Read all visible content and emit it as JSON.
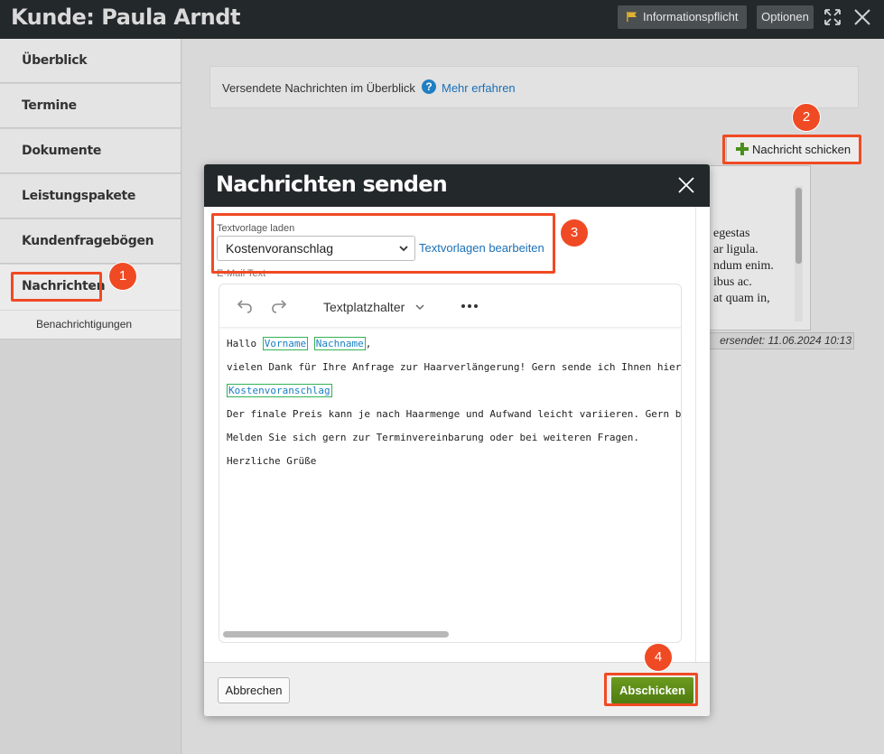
{
  "header": {
    "title": "Kunde: Paula Arndt",
    "info_button": "Informationspflicht",
    "options_button": "Optionen"
  },
  "sidebar": {
    "items": [
      {
        "label": "Überblick"
      },
      {
        "label": "Termine"
      },
      {
        "label": "Dokumente"
      },
      {
        "label": "Leistungspakete"
      },
      {
        "label": "Kundenfragebögen"
      }
    ],
    "active_item": "Nachrichten",
    "sub_item": "Benachrichtigungen"
  },
  "main": {
    "info_text": "Versendete Nachrichten im Überblick",
    "info_link": "Mehr erfahren",
    "new_message_button": "Nachricht schicken",
    "message_preview_lines": [
      "egestas",
      "ar ligula.",
      "ndum enim.",
      "ibus ac.",
      "at quam in,"
    ],
    "sent_label": "ersendet: 11.06.2024 10:13"
  },
  "modal": {
    "title": "Nachrichten senden",
    "template_label": "Textvorlage laden",
    "template_selected": "Kostenvoranschlag",
    "template_edit_link": "Textvorlagen bearbeiten",
    "email_label": "E-Mail Text",
    "toolbar": {
      "placeholder_menu": "Textplatzhalter"
    },
    "email_body": {
      "greeting": "Hallo",
      "ph_first": "Vorname",
      "ph_last": "Nachname",
      "comma": ",",
      "line2": "vielen Dank für Ihre Anfrage zur Haarverlängerung! Gern sende ich Ihnen hier",
      "ph_quote": "Kostenvoranschlag",
      "line4": "Der finale Preis kann je nach Haarmenge und Aufwand leicht variieren. Gern b",
      "line5": "Melden Sie sich gern zur Terminvereinbarung oder bei weiteren Fragen.",
      "line6": "Herzliche Grüße"
    },
    "cancel_button": "Abbrechen",
    "send_button": "Abschicken"
  },
  "annotations": [
    "1",
    "2",
    "3",
    "4"
  ],
  "colors": {
    "topbar": "#23282b",
    "annotation": "#f04a24",
    "link": "#1a70b8",
    "send_button": "#5a8a16",
    "placeholder_border": "#33b255"
  }
}
